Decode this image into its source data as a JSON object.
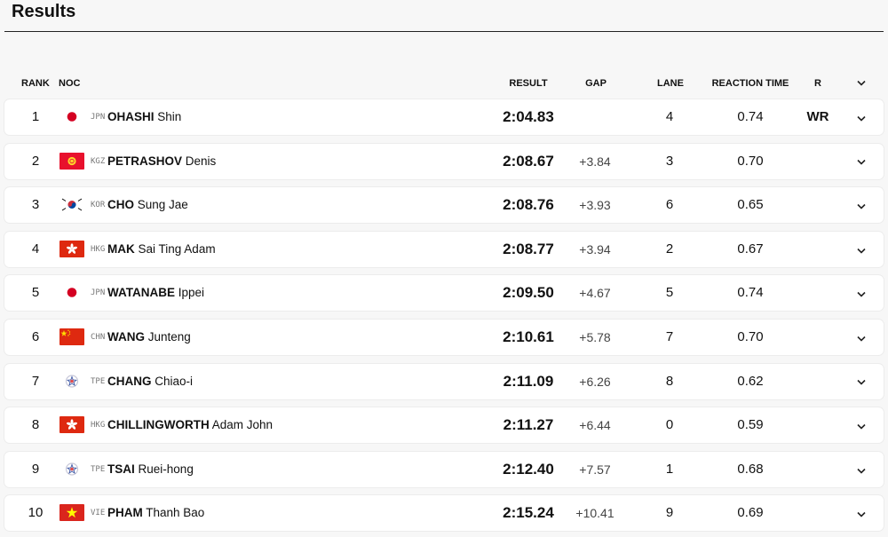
{
  "page": {
    "title": "Results"
  },
  "columns": {
    "rank": "RANK",
    "noc": "NOC",
    "result": "RESULT",
    "gap": "GAP",
    "lane": "LANE",
    "reaction_time": "REACTION TIME",
    "r": "R"
  },
  "colors": {
    "accent": "#111111",
    "row_bg": "#ffffff",
    "page_bg": "#f7f7f7"
  },
  "rows": [
    {
      "rank": "1",
      "noc": "JPN",
      "last": "OHASHI",
      "first": "Shin",
      "result": "2:04.83",
      "gap": "",
      "lane": "4",
      "reaction": "0.74",
      "r": "WR",
      "flag_icon": "japan-flag-icon"
    },
    {
      "rank": "2",
      "noc": "KGZ",
      "last": "PETRASHOV",
      "first": "Denis",
      "result": "2:08.67",
      "gap": "+3.84",
      "lane": "3",
      "reaction": "0.70",
      "r": "",
      "flag_icon": "kyrgyzstan-flag-icon"
    },
    {
      "rank": "3",
      "noc": "KOR",
      "last": "CHO",
      "first": "Sung Jae",
      "result": "2:08.76",
      "gap": "+3.93",
      "lane": "6",
      "reaction": "0.65",
      "r": "",
      "flag_icon": "korea-flag-icon"
    },
    {
      "rank": "4",
      "noc": "HKG",
      "last": "MAK",
      "first": "Sai Ting Adam",
      "result": "2:08.77",
      "gap": "+3.94",
      "lane": "2",
      "reaction": "0.67",
      "r": "",
      "flag_icon": "hong-kong-flag-icon"
    },
    {
      "rank": "5",
      "noc": "JPN",
      "last": "WATANABE",
      "first": "Ippei",
      "result": "2:09.50",
      "gap": "+4.67",
      "lane": "5",
      "reaction": "0.74",
      "r": "",
      "flag_icon": "japan-flag-icon"
    },
    {
      "rank": "6",
      "noc": "CHN",
      "last": "WANG",
      "first": "Junteng",
      "result": "2:10.61",
      "gap": "+5.78",
      "lane": "7",
      "reaction": "0.70",
      "r": "",
      "flag_icon": "china-flag-icon"
    },
    {
      "rank": "7",
      "noc": "TPE",
      "last": "CHANG",
      "first": "Chiao-i",
      "result": "2:11.09",
      "gap": "+6.26",
      "lane": "8",
      "reaction": "0.62",
      "r": "",
      "flag_icon": "chinese-taipei-flag-icon"
    },
    {
      "rank": "8",
      "noc": "HKG",
      "last": "CHILLINGWORTH",
      "first": "Adam John",
      "result": "2:11.27",
      "gap": "+6.44",
      "lane": "0",
      "reaction": "0.59",
      "r": "",
      "flag_icon": "hong-kong-flag-icon"
    },
    {
      "rank": "9",
      "noc": "TPE",
      "last": "TSAI",
      "first": "Ruei-hong",
      "result": "2:12.40",
      "gap": "+7.57",
      "lane": "1",
      "reaction": "0.68",
      "r": "",
      "flag_icon": "chinese-taipei-flag-icon"
    },
    {
      "rank": "10",
      "noc": "VIE",
      "last": "PHAM",
      "first": "Thanh Bao",
      "result": "2:15.24",
      "gap": "+10.41",
      "lane": "9",
      "reaction": "0.69",
      "r": "",
      "flag_icon": "vietnam-flag-icon"
    }
  ]
}
